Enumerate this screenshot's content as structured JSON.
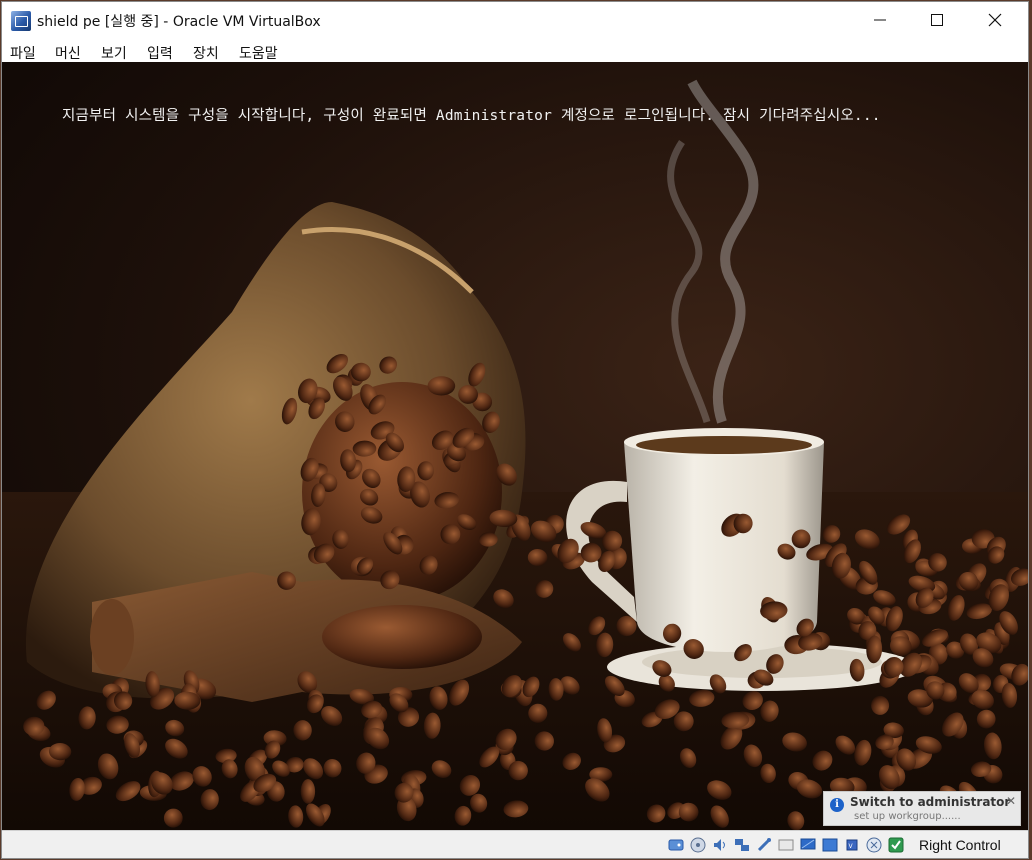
{
  "window": {
    "title": "shield pe [실행 중] - Oracle VM VirtualBox",
    "app_icon": "virtualbox-icon"
  },
  "menu": {
    "items": [
      {
        "label": "파일"
      },
      {
        "label": "머신"
      },
      {
        "label": "보기"
      },
      {
        "label": "입력"
      },
      {
        "label": "장치"
      },
      {
        "label": "도움말"
      }
    ]
  },
  "guest_screen": {
    "message": "지금부터 시스템을 구성을 시작합니다, 구성이 완료되면 Administrator 계정으로 로그인됩니다. 잠시 기다려주십시오..."
  },
  "notification": {
    "title": "Switch to administrator",
    "subtitle": "set up workgroup......",
    "icon": "info-icon"
  },
  "statusbar": {
    "icons": [
      "hard-disk-icon",
      "optical-drive-icon",
      "audio-icon",
      "network-icon",
      "usb-icon",
      "shared-folders-icon",
      "display-icon",
      "video-capture-icon",
      "cpu-icon",
      "mouse-integration-icon",
      "host-key-icon"
    ],
    "host_key": "Right Control"
  }
}
